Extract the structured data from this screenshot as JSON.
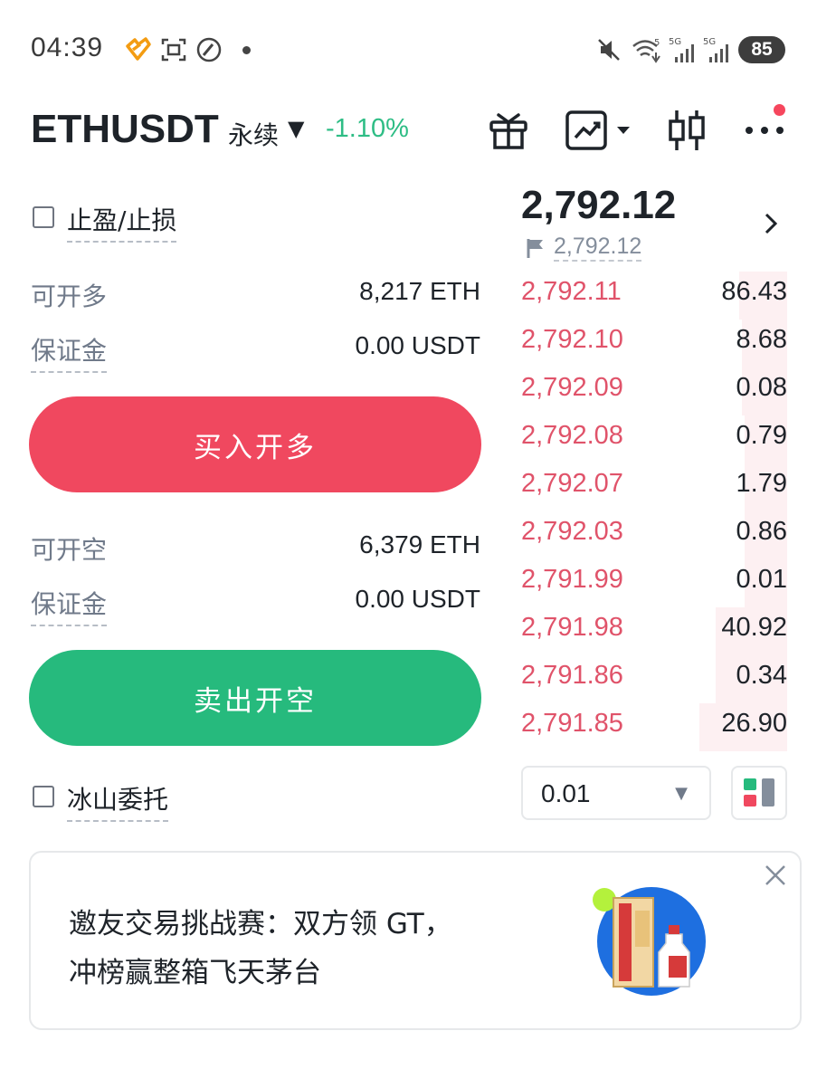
{
  "status_bar": {
    "time": "04:39",
    "battery": "85",
    "icons": [
      "heart-app-icon",
      "scan-icon",
      "speed-icon",
      "dot-icon",
      "mute-icon",
      "wifi-icon",
      "signal-5g-icon",
      "signal-5g-icon",
      "battery-icon"
    ]
  },
  "header": {
    "symbol": "ETHUSDT",
    "contract_type": "永续",
    "change": "-1.10%",
    "icons": [
      "gift-icon",
      "chart-icon",
      "candlestick-icon",
      "more-icon"
    ]
  },
  "form": {
    "tpsl_label": "止盈/止损",
    "long": {
      "label": "可开多",
      "value": "8,217 ETH"
    },
    "long_margin": {
      "label": "保证金",
      "value": "0.00 USDT"
    },
    "buy_button": "买入开多",
    "short": {
      "label": "可开空",
      "value": "6,379 ETH"
    },
    "short_margin": {
      "label": "保证金",
      "value": "0.00 USDT"
    },
    "sell_button": "卖出开空",
    "iceberg_label": "冰山委托"
  },
  "orderbook": {
    "last_price": "2,792.12",
    "mark_price": "2,792.12",
    "asks": [
      {
        "price": "2,792.11",
        "qty": "86.43",
        "depth": 0.18
      },
      {
        "price": "2,792.10",
        "qty": "8.68",
        "depth": 0.17
      },
      {
        "price": "2,792.09",
        "qty": "0.08",
        "depth": 0.17
      },
      {
        "price": "2,792.08",
        "qty": "0.79",
        "depth": 0.16
      },
      {
        "price": "2,792.07",
        "qty": "1.79",
        "depth": 0.16
      },
      {
        "price": "2,792.03",
        "qty": "0.86",
        "depth": 0.16
      },
      {
        "price": "2,791.99",
        "qty": "0.01",
        "depth": 0.16
      },
      {
        "price": "2,791.98",
        "qty": "40.92",
        "depth": 0.27
      },
      {
        "price": "2,791.86",
        "qty": "0.34",
        "depth": 0.27
      },
      {
        "price": "2,791.85",
        "qty": "26.90",
        "depth": 0.33
      }
    ],
    "precision": "0.01"
  },
  "promo": {
    "line1": "邀友交易挑战赛：双方领 GT，",
    "line2": "冲榜赢整箱飞天茅台"
  },
  "colors": {
    "buy": "#f0485f",
    "sell": "#26ba7d",
    "ask_price": "#e0536a",
    "change": "#2ebd85"
  }
}
